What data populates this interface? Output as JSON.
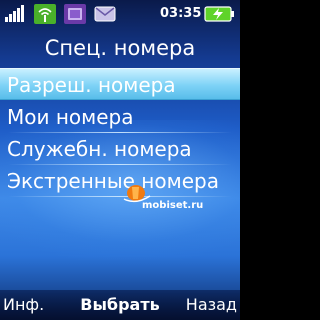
{
  "status": {
    "time": "03:35",
    "icons": [
      "signal-bars-icon",
      "wifi-antenna-icon",
      "purple-app-icon",
      "message-icon",
      "battery-charging-icon"
    ]
  },
  "title": "Спец. номера",
  "menu": {
    "items": [
      {
        "label": "Разреш. номера",
        "selected": true
      },
      {
        "label": "Мои номера",
        "selected": false
      },
      {
        "label": "Служебн. номера",
        "selected": false
      },
      {
        "label": "Экстренные номера",
        "selected": false
      }
    ]
  },
  "watermark": "mobiset.ru",
  "softkeys": {
    "left": "Инф.",
    "center": "Выбрать",
    "right": "Назад"
  },
  "colors": {
    "background_top": "#0a1a4a",
    "background_mid": "#3f8ae8",
    "selection": "#7ed2f6",
    "battery": "#5fd32a",
    "logo_orange": "#f07a10"
  }
}
